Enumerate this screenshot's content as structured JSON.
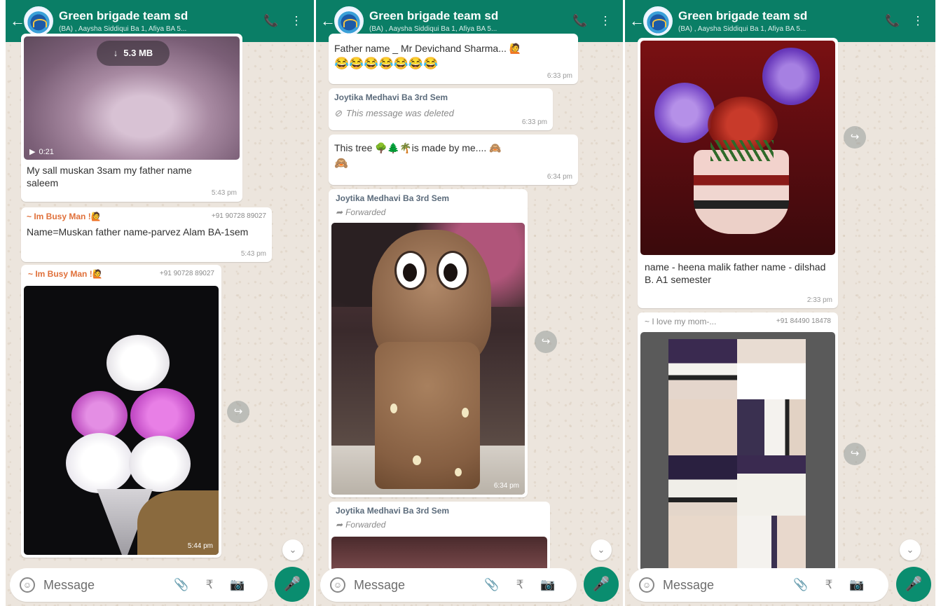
{
  "chat": {
    "title": "Green brigade team sd",
    "subtitle": "(BA) , Aaysha Siddiqui Ba 1, Afiya BA 5...",
    "message_placeholder": "Message"
  },
  "icons": {
    "back": "←",
    "call": "📞",
    "menu": "⋮",
    "share": "↪",
    "scroll_down": "⌄",
    "mic": "🎤",
    "emoji": "☺",
    "attach": "📎",
    "payment": "₹",
    "camera": "📷",
    "download": "↓",
    "video": "▶",
    "forward": "➦",
    "deleted": "⊘"
  },
  "panel1": {
    "video_size": "5.3 MB",
    "video_duration": "0:21",
    "msg1_text": "My sall muskan 3sam my father name saleem",
    "msg1_time": "5:43 pm",
    "msg2_sender": "~ Im Busy Man !🙋",
    "msg2_phone": "+91 90728 89027",
    "msg2_text": "Name=Muskan father name-parvez Alam BA-1sem",
    "msg2_time": "5:43 pm",
    "msg3_sender": "~ Im Busy Man !🙋",
    "msg3_phone": "+91 90728 89027",
    "msg3_time": "5:44 pm"
  },
  "panel2": {
    "msg1_text": "Father name _ Mr Devichand Sharma... 🙋",
    "msg1_emoji": "😂😂😂😂😂😂😂",
    "msg1_time": "6:33 pm",
    "msg2_sender": "Joytika Medhavi Ba 3rd Sem",
    "msg2_text": "This message was deleted",
    "msg2_time": "6:33 pm",
    "msg3_text": "This tree 🌳🌲🌴is made by me.... 🙈",
    "msg3_emoji": "🙈",
    "msg3_time": "6:34 pm",
    "msg4_sender": "Joytika Medhavi Ba 3rd Sem",
    "msg4_forwarded": "Forwarded",
    "msg4_time": "6:34 pm",
    "msg5_sender": "Joytika Medhavi Ba 3rd Sem",
    "msg5_forwarded": "Forwarded"
  },
  "panel3": {
    "msg1_text": "name - heena malik father name - dilshad B. A1 semester",
    "msg1_time": "2:33 pm",
    "msg2_sender": "~ I love my mom-...",
    "msg2_phone": "+91 84490 18478"
  }
}
